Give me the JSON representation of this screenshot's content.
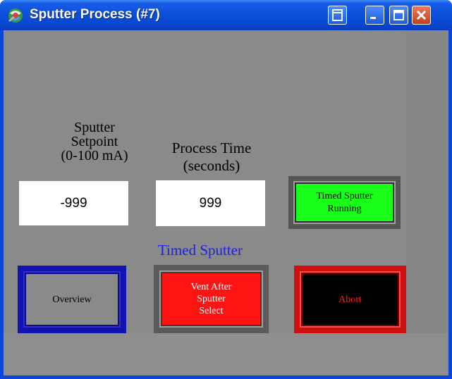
{
  "window": {
    "title": "Sputter Process (#7)",
    "title_color": "#ffffff",
    "titlebar_color": "#0a47cf",
    "buttons": [
      "restore-sysmenu",
      "minimize",
      "maximize",
      "close"
    ]
  },
  "fields": {
    "setpoint": {
      "label": "Sputter\nSetpoint\n(0-100 mA)",
      "value": "-999"
    },
    "process_time": {
      "label": "Process Time\n(seconds)",
      "value": "999"
    }
  },
  "status": {
    "label": "Timed Sputter\nRunning",
    "color": "#1aff1a"
  },
  "section_label": "Timed Sputter",
  "section_label_color": "#1e1ee6",
  "buttons": {
    "overview": {
      "label": "Overview",
      "border_color": "#1212b0"
    },
    "vent": {
      "label": "Vent After\nSputter\nSelect",
      "color": "#ff1414"
    },
    "abort": {
      "label": "Abort",
      "color": "#000000",
      "text_color": "#ff1a1a"
    }
  },
  "panel_color": "#8a8a8a"
}
